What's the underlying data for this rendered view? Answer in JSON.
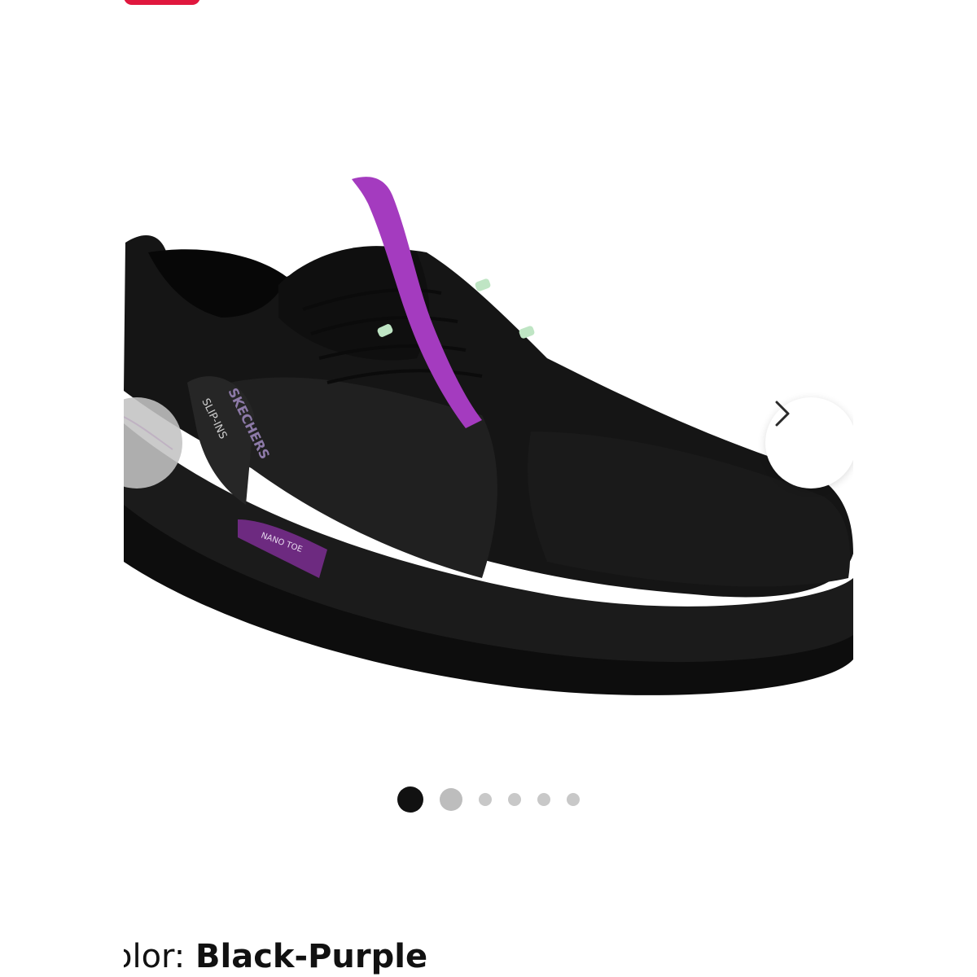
{
  "gallery": {
    "current_index": 1,
    "total_images": 6,
    "image": {
      "alt": "Black-Purple",
      "brand_text": "SKECHERS",
      "label_text": "SLIP-INS",
      "toe_text": "NANO TOE"
    },
    "prev_icon": "chevron-left-icon",
    "next_icon": "chevron-right-icon"
  },
  "color": {
    "label": "olor:",
    "value": "Black-Purple"
  },
  "colors": {
    "accent": "#e0173e",
    "shoe_body": "#151515",
    "strap_purple": "#a43bbf",
    "lace_tips": "#bfe5c4"
  }
}
